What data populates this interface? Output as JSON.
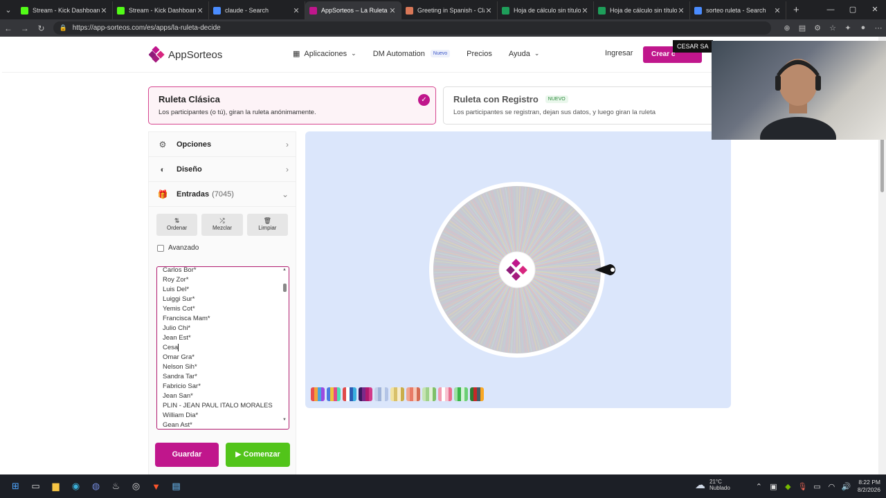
{
  "browser": {
    "tabs": [
      {
        "title": "Stream - Kick Dashboard",
        "color": "#53fc18",
        "active": false
      },
      {
        "title": "Stream - Kick Dashboard",
        "color": "#53fc18",
        "active": false
      },
      {
        "title": "claude - Search",
        "color": "#4a8cff",
        "active": false
      },
      {
        "title": "AppSorteos – La Ruleta de la",
        "color": "#c0168c",
        "active": true
      },
      {
        "title": "Greeting in Spanish - Claude",
        "color": "#d97757",
        "active": false
      },
      {
        "title": "Hoja de cálculo sin título - H",
        "color": "#1e9e5a",
        "active": false
      },
      {
        "title": "Hoja de cálculo sin título - H",
        "color": "#1e9e5a",
        "active": false
      },
      {
        "title": "sorteo ruleta - Search",
        "color": "#4a8cff",
        "active": false
      }
    ],
    "url": "https://app-sorteos.com/es/apps/la-ruleta-decide"
  },
  "header": {
    "logo_text": "AppSorteos",
    "nav": {
      "apps": "Aplicaciones",
      "dm": "DM Automation",
      "dm_badge": "Nuevo",
      "prices": "Precios",
      "help": "Ayuda"
    },
    "login": "Ingresar",
    "create": "Crear c"
  },
  "cards": {
    "classic": {
      "title": "Ruleta Clásica",
      "desc": "Los participantes (o tú), giran la ruleta anónimamente."
    },
    "registro": {
      "title": "Ruleta con Registro",
      "badge": "NUEVO",
      "desc": "Los participantes se registran, dejan sus datos, y luego giran la ruleta"
    }
  },
  "panel": {
    "opciones": "Opciones",
    "diseno": "Diseño",
    "entradas": "Entradas",
    "entradas_count": "(7045)",
    "ordenar": "Ordenar",
    "mezclar": "Mezclar",
    "limpiar": "Limpiar",
    "avanzado": "Avanzado",
    "entries": [
      "Carlos Bor*",
      "Roy Zor*",
      "Luis Del*",
      "Luiggi Sur*",
      "Yemis Cot*",
      "Francisca Mam*",
      "Julio Chi*",
      "Jean Est*",
      "Cesa",
      "Omar Gra*",
      "Nelson Sih*",
      "Sandra Tar*",
      "Fabricio Sar*",
      "Jean San*",
      "PLIN - JEAN PAUL ITALO MORALES",
      "William Dia*",
      "Gean Ast*"
    ],
    "guardar": "Guardar",
    "comenzar": "Comenzar"
  },
  "webcam": {
    "label": "CESAR SA"
  },
  "taskbar": {
    "temp": "21°C",
    "weather": "Nublado",
    "time": "8:22 PM",
    "date": "8/2/2026"
  },
  "colors": {
    "brand": "#c0168c",
    "go": "#52c41a",
    "stage": "#dbe6fb"
  }
}
